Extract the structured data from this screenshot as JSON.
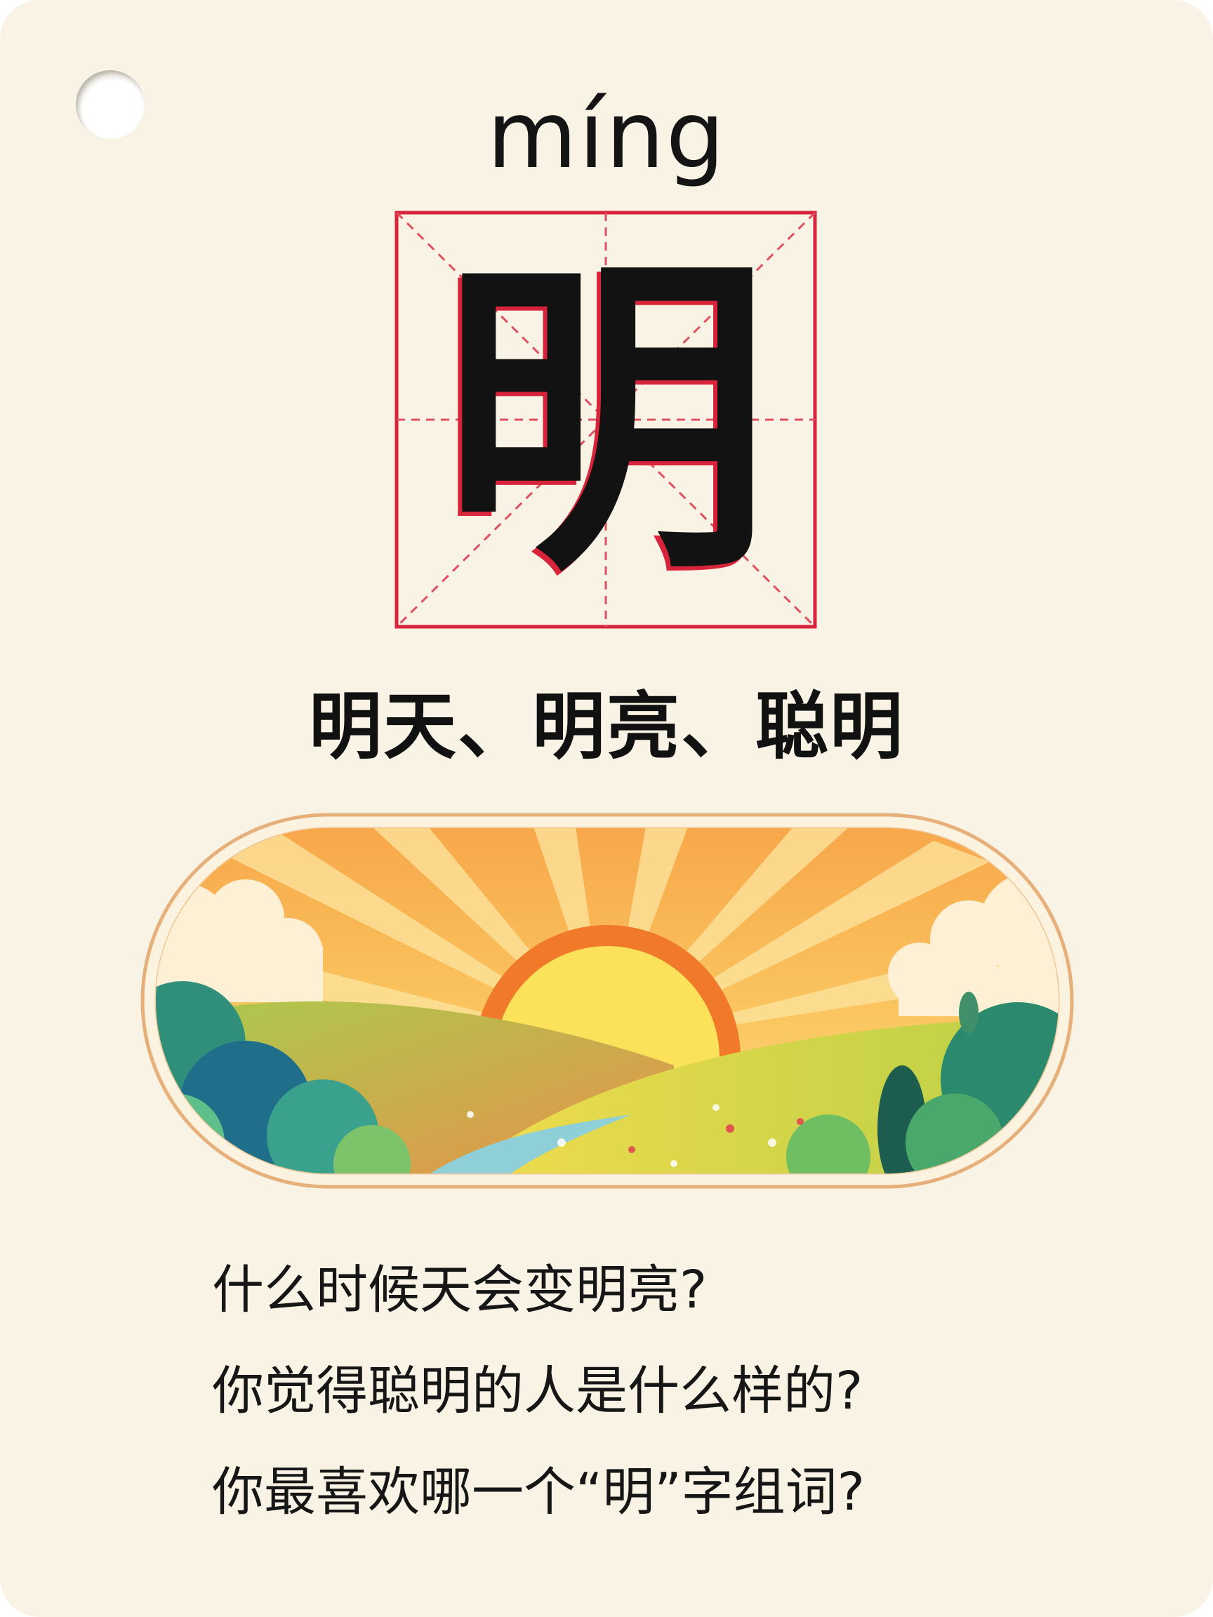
{
  "card": {
    "pinyin": "míng",
    "character": "明",
    "words": "明天、明亮、聪明",
    "illustration": "sunrise-over-hills",
    "colors": {
      "background": "#f8f3e4",
      "grid_red": "#d8243a",
      "sun_ring": "#f07a2a",
      "sun_core": "#fbe25a"
    },
    "questions": [
      "什么时候天会变明亮?",
      "你觉得聪明的人是什么样的?",
      "你最喜欢哪一个“明”字组词?"
    ]
  }
}
